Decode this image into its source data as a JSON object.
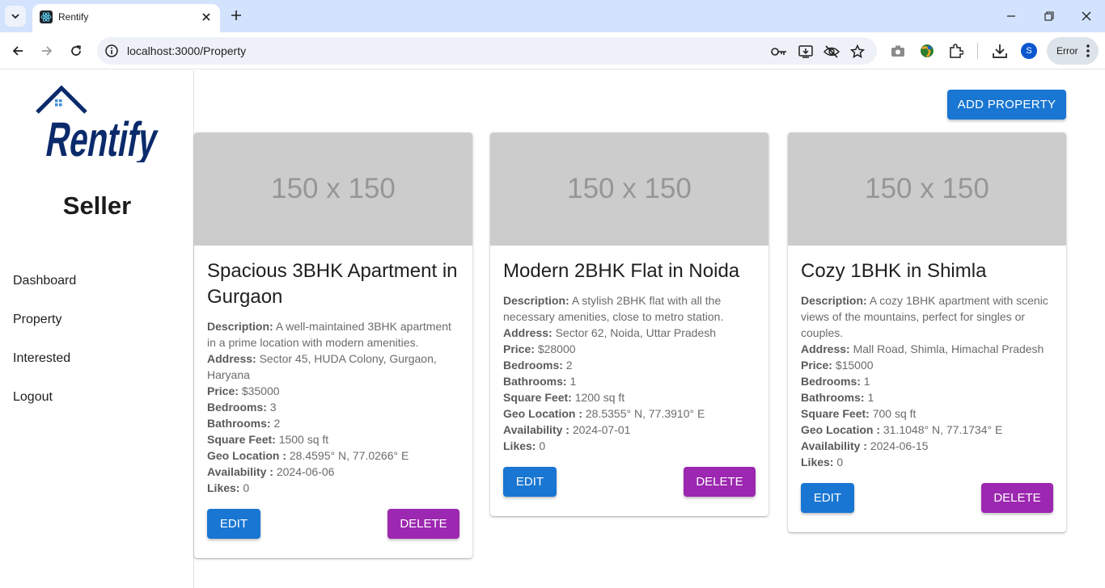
{
  "browser": {
    "tab_title": "Rentify",
    "url": "localhost:3000/Property",
    "profile_initial": "S",
    "error_label": "Error"
  },
  "sidebar": {
    "logo_text": "Rentify",
    "role": "Seller",
    "items": [
      {
        "label": "Dashboard"
      },
      {
        "label": "Property"
      },
      {
        "label": "Interested"
      },
      {
        "label": "Logout"
      }
    ]
  },
  "main": {
    "add_button": "ADD PROPERTY",
    "labels": {
      "description": "Description:",
      "address": "Address:",
      "price": "Price:",
      "bedrooms": "Bedrooms:",
      "bathrooms": "Bathrooms:",
      "square_feet": "Square Feet:",
      "geo_location": "Geo Location :",
      "availability": "Availability :",
      "likes": "Likes:",
      "edit": "EDIT",
      "delete": "DELETE"
    },
    "properties": [
      {
        "image_placeholder": "150 x 150",
        "title": "Spacious 3BHK Apartment in Gurgaon",
        "description": "A well-maintained 3BHK apartment in a prime location with modern amenities.",
        "address": "Sector 45, HUDA Colony, Gurgaon, Haryana",
        "price": "$35000",
        "bedrooms": "3",
        "bathrooms": "2",
        "square_feet": "1500 sq ft",
        "geo_location": "28.4595° N, 77.0266° E",
        "availability": "2024-06-06",
        "likes": "0"
      },
      {
        "image_placeholder": "150 x 150",
        "title": "Modern 2BHK Flat in Noida",
        "description": "A stylish 2BHK flat with all the necessary amenities, close to metro station.",
        "address": "Sector 62, Noida, Uttar Pradesh",
        "price": "$28000",
        "bedrooms": "2",
        "bathrooms": "1",
        "square_feet": "1200 sq ft",
        "geo_location": "28.5355° N, 77.3910° E",
        "availability": "2024-07-01",
        "likes": "0"
      },
      {
        "image_placeholder": "150 x 150",
        "title": "Cozy 1BHK in Shimla",
        "description": "A cozy 1BHK apartment with scenic views of the mountains, perfect for singles or couples.",
        "address": "Mall Road, Shimla, Himachal Pradesh",
        "price": "$15000",
        "bedrooms": "1",
        "bathrooms": "1",
        "square_feet": "700 sq ft",
        "geo_location": "31.1048° N, 77.1734° E",
        "availability": "2024-06-15",
        "likes": "0"
      }
    ]
  },
  "colors": {
    "primary": "#1976d2",
    "secondary": "#9c27b0",
    "logo_navy": "#0b2a6b",
    "placeholder_bg": "#cccccc"
  }
}
